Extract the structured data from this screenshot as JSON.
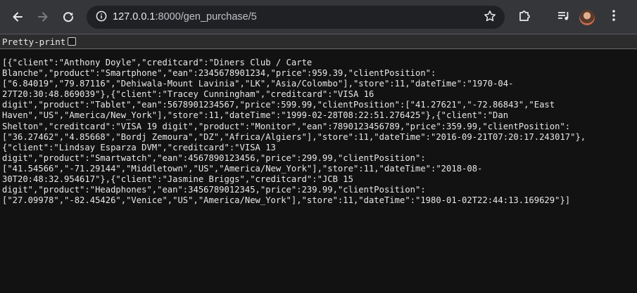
{
  "browser": {
    "url_host": "127.0.0.1",
    "url_rest": ":8000/gen_purchase/5"
  },
  "pretty_print": {
    "label": "Pretty-print",
    "checked": false
  },
  "json_lines": [
    "[{\"client\":\"Anthony Doyle\",\"creditcard\":\"Diners Club / Carte",
    "Blanche\",\"product\":\"Smartphone\",\"ean\":2345678901234,\"price\":959.39,\"clientPosition\":",
    "[\"6.84019\",\"79.87116\",\"Dehiwala-Mount Lavinia\",\"LK\",\"Asia/Colombo\"],\"store\":11,\"dateTime\":\"1970-04-",
    "27T20:30:48.869039\"},{\"client\":\"Tracey Cunningham\",\"creditcard\":\"VISA 16",
    "digit\",\"product\":\"Tablet\",\"ean\":5678901234567,\"price\":599.99,\"clientPosition\":[\"41.27621\",\"-72.86843\",\"East",
    "Haven\",\"US\",\"America/New_York\"],\"store\":11,\"dateTime\":\"1999-02-28T08:22:51.276425\"},{\"client\":\"Dan",
    "Shelton\",\"creditcard\":\"VISA 19 digit\",\"product\":\"Monitor\",\"ean\":7890123456789,\"price\":359.99,\"clientPosition\":",
    "[\"36.27462\",\"4.85668\",\"Bordj Zemoura\",\"DZ\",\"Africa/Algiers\"],\"store\":11,\"dateTime\":\"2016-09-21T07:20:17.243017\"},",
    "{\"client\":\"Lindsay Esparza DVM\",\"creditcard\":\"VISA 13",
    "digit\",\"product\":\"Smartwatch\",\"ean\":4567890123456,\"price\":299.99,\"clientPosition\":",
    "[\"41.54566\",\"-71.29144\",\"Middletown\",\"US\",\"America/New_York\"],\"store\":11,\"dateTime\":\"2018-08-",
    "30T20:48:32.954617\"},{\"client\":\"Jasmine Briggs\",\"creditcard\":\"JCB 15",
    "digit\",\"product\":\"Headphones\",\"ean\":3456789012345,\"price\":239.99,\"clientPosition\":",
    "[\"27.09978\",\"-82.45426\",\"Venice\",\"US\",\"America/New_York\"],\"store\":11,\"dateTime\":\"1980-01-02T22:44:13.169629\"}]"
  ]
}
